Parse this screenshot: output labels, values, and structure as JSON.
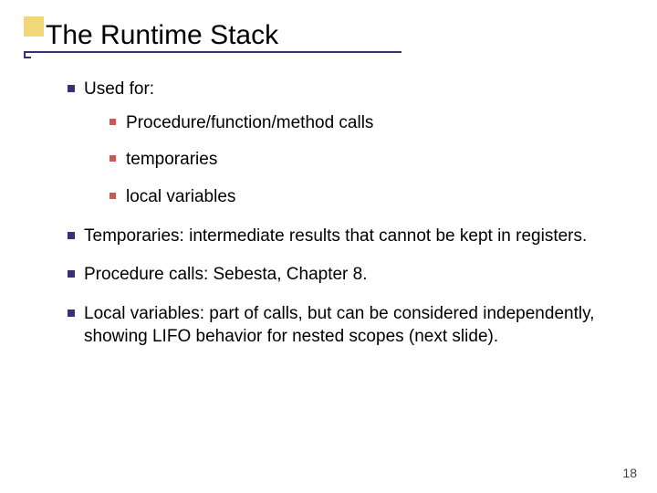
{
  "title": "The Runtime Stack",
  "bullets": {
    "b1": {
      "text": "Used for:",
      "sub": {
        "s1": "Procedure/function/method calls",
        "s2": "temporaries",
        "s3": "local variables"
      }
    },
    "b2": "Temporaries: intermediate results that cannot be kept in registers.",
    "b3": "Procedure calls: Sebesta, Chapter 8.",
    "b4": "Local variables: part of calls, but can be considered independently, showing LIFO behavior for nested scopes (next slide)."
  },
  "page_number": "18"
}
